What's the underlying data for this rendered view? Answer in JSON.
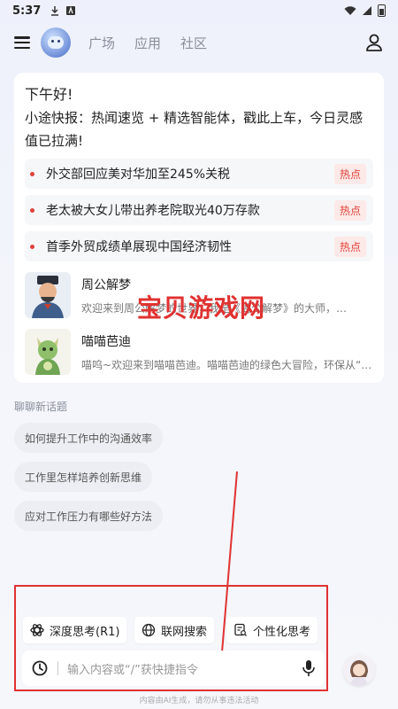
{
  "status_bar": {
    "time": "5:37"
  },
  "header": {
    "tabs": [
      {
        "label": "广场"
      },
      {
        "label": "应用"
      },
      {
        "label": "社区"
      }
    ]
  },
  "card": {
    "greeting": "下午好!",
    "intro": "小途快报：热闻速览 + 精选智能体，戳此上车，今日灵感值已拉满!",
    "news": [
      {
        "text": "外交部回应美对华加至245%关税",
        "badge": "热点"
      },
      {
        "text": "老太被大女儿带出养老院取光40万存款",
        "badge": "热点"
      },
      {
        "text": "首季外贸成绩单展现中国经济韧性",
        "badge": "热点"
      }
    ],
    "agents": [
      {
        "name": "周公解梦",
        "desc": "欢迎来到周公解梦的世界，我是《周公解梦》的大师，…"
      },
      {
        "name": "喵喵芭迪",
        "desc": "喵呜~欢迎来到喵喵芭迪。喵喵芭迪的绿色大冒险，环保从“…"
      }
    ]
  },
  "watermark": "宝贝游戏网",
  "topics": {
    "title": "聊聊新话题",
    "items": [
      "如何提升工作中的沟通效率",
      "工作里怎样培养创新思维",
      "应对工作压力有哪些好方法"
    ]
  },
  "chips": [
    {
      "label": "深度思考(R1)",
      "icon": "deep-think-icon"
    },
    {
      "label": "联网搜索",
      "icon": "globe-icon"
    },
    {
      "label": "个性化思考",
      "icon": "document-search-icon"
    }
  ],
  "input": {
    "placeholder": "输入内容或“/”获快捷指令"
  },
  "footer_note": "内容由AI生成，请勿从事违法活动",
  "colors": {
    "hot": "#e0423a",
    "annotation": "#e03232"
  }
}
